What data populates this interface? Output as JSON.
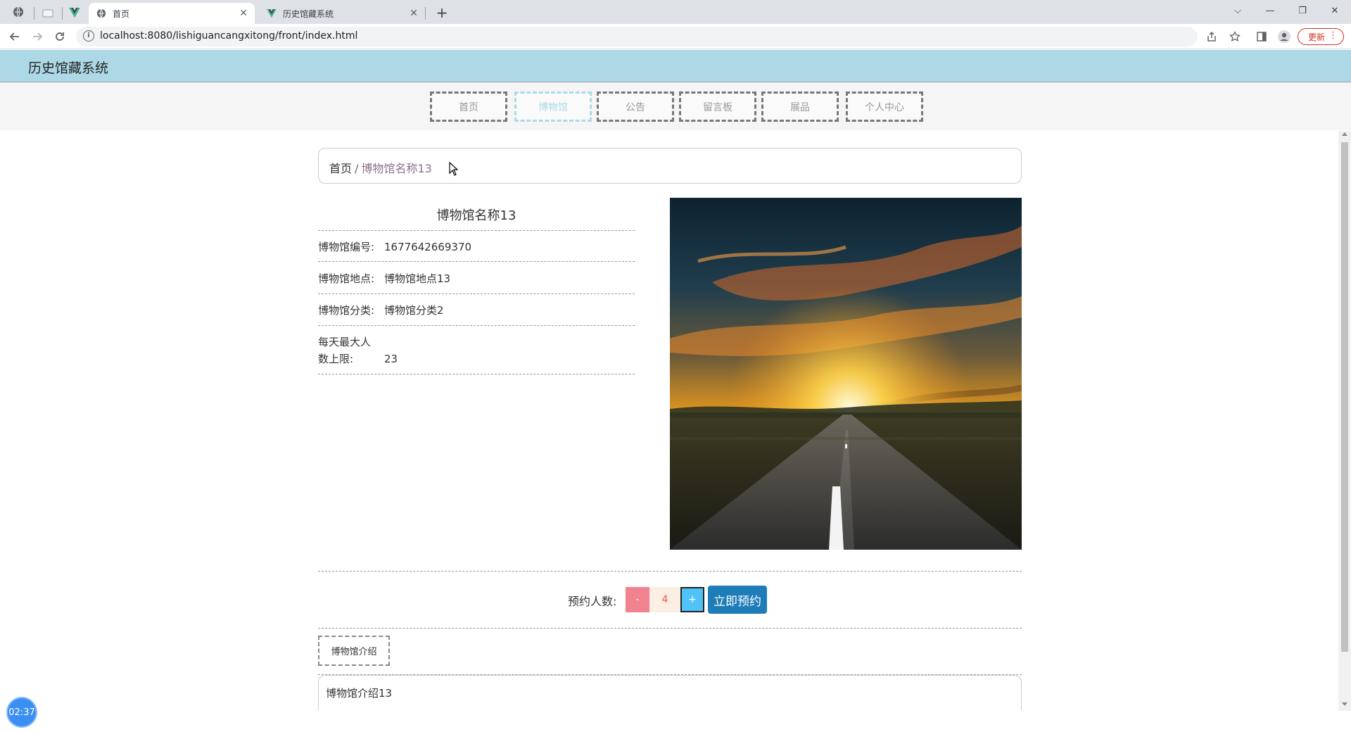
{
  "browser": {
    "tabs": [
      {
        "title": "首页",
        "active": true
      },
      {
        "title": "历史馆藏系统",
        "active": false
      }
    ],
    "new_tab": "+",
    "url": "localhost:8080/lishiguancangxitong/front/index.html",
    "update_label": "更新",
    "window_controls": {
      "dropdown": "⌵",
      "minimize": "—",
      "restore": "❐",
      "close": "✕"
    }
  },
  "site": {
    "title": "历史馆藏系统",
    "nav": [
      "首页",
      "博物馆",
      "公告",
      "留言板",
      "展品",
      "个人中心"
    ],
    "active_nav_index": 1
  },
  "breadcrumb": {
    "home": "首页",
    "separator": "/",
    "current": "博物馆名称13"
  },
  "detail": {
    "title": "博物馆名称13",
    "fields": [
      {
        "label": "博物馆编号:",
        "value": "1677642669370"
      },
      {
        "label": "博物馆地点:",
        "value": "博物馆地点13"
      },
      {
        "label": "博物馆分类:",
        "value": "博物馆分类2"
      },
      {
        "label_line1": "每天最大人",
        "label_line2": "数上限:",
        "value": "23"
      }
    ],
    "image_alt": "sunset road photo"
  },
  "booking": {
    "label": "预约人数:",
    "minus": "-",
    "quantity": "4",
    "plus": "+",
    "button": "立即预约"
  },
  "intro": {
    "tab": "博物馆介绍",
    "content": "博物馆介绍13"
  },
  "timer": "02:37",
  "colors": {
    "header_bg": "#add8e6",
    "active_nav": "#add8e6",
    "book_button": "#1e7cb8",
    "minus_button": "#f0838f",
    "plus_button": "#4fc3f7"
  }
}
